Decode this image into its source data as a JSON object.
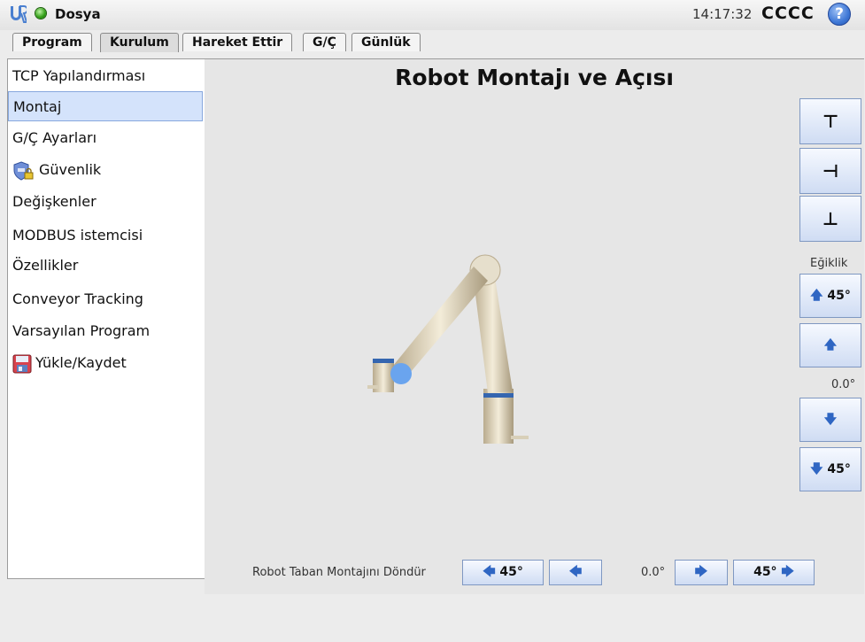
{
  "header": {
    "logo_icon": "universal-robots-logo",
    "status_icon": "green-status-dot",
    "file_label": "Dosya",
    "time": "14:17:32",
    "robot_name": "CCCC",
    "help_label": "?"
  },
  "tabs": [
    "Program",
    "Kurulum",
    "Hareket Ettir",
    "G/Ç",
    "Günlük"
  ],
  "active_tab": "Kurulum",
  "sidebar": {
    "items": [
      {
        "label": "TCP Yapılandırması"
      },
      {
        "label": "Montaj"
      },
      {
        "label": "G/Ç Ayarları"
      },
      {
        "label": "Güvenlik",
        "icon": "shield-lock-icon"
      },
      {
        "label": "Değişkenler"
      },
      {
        "label": "MODBUS istemcisi"
      },
      {
        "label": "Özellikler"
      },
      {
        "label": "Conveyor Tracking"
      },
      {
        "label": "Varsayılan Program"
      },
      {
        "label": "Yükle/Kaydet",
        "icon": "floppy-disk-icon"
      }
    ],
    "selected": "Montaj"
  },
  "main": {
    "title": "Robot Montajı ve Açısı",
    "mount_buttons": [
      {
        "icon": "mount-ceiling-icon",
        "glyph": "⊥"
      },
      {
        "icon": "mount-wall-icon",
        "glyph": "⊣"
      },
      {
        "icon": "mount-floor-icon",
        "glyph": "⊥"
      }
    ],
    "tilt": {
      "label": "Eğiklik",
      "up45": "45°",
      "down45": "45°",
      "value": "0.0°"
    },
    "rotate": {
      "label": "Robot Taban Montajını Döndür",
      "left45": "45°",
      "right45": "45°",
      "value": "0.0°"
    }
  },
  "colors": {
    "accent": "#2f66c3",
    "selection": "#d4e3fb",
    "status_green": "#2f9d14",
    "help_blue": "#3f78d6"
  }
}
